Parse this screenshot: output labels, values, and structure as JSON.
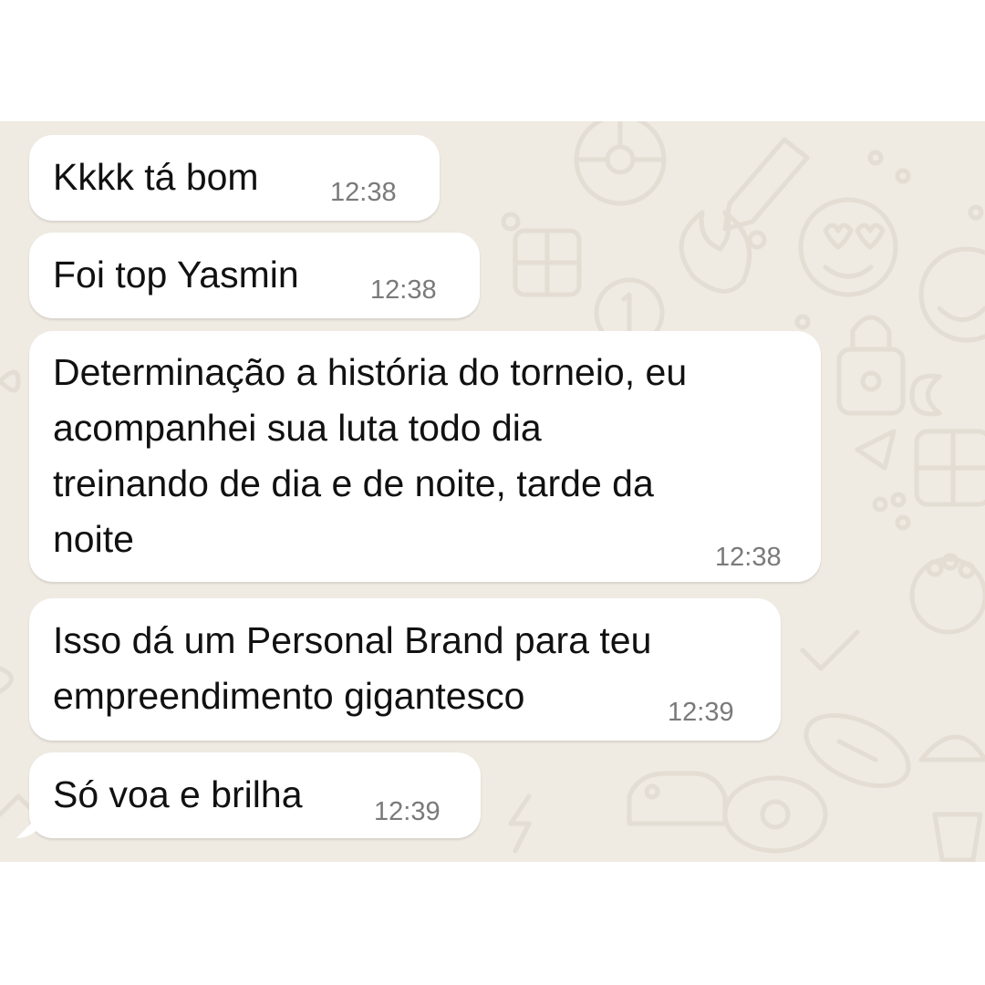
{
  "chat": {
    "messages": [
      {
        "lines": [
          "Kkkk tá bom"
        ],
        "time": "12:38"
      },
      {
        "lines": [
          "Foi top Yasmin"
        ],
        "time": "12:38"
      },
      {
        "lines": [
          "Determinação a história do torneio, eu",
          "acompanhei sua luta todo dia",
          "treinando de dia e de noite, tarde da",
          "noite"
        ],
        "time": "12:38"
      },
      {
        "lines": [
          "Isso dá um Personal Brand para teu",
          "empreendimento gigantesco"
        ],
        "time": "12:39"
      },
      {
        "lines": [
          "Só voa e brilha"
        ],
        "time": "12:39"
      }
    ]
  },
  "colors": {
    "wallpaper": "#efeae2",
    "bubble": "#ffffff",
    "text": "#111111",
    "timestamp": "#7a7a7a"
  },
  "icons": [
    "wallpaper-doodle-pattern"
  ]
}
